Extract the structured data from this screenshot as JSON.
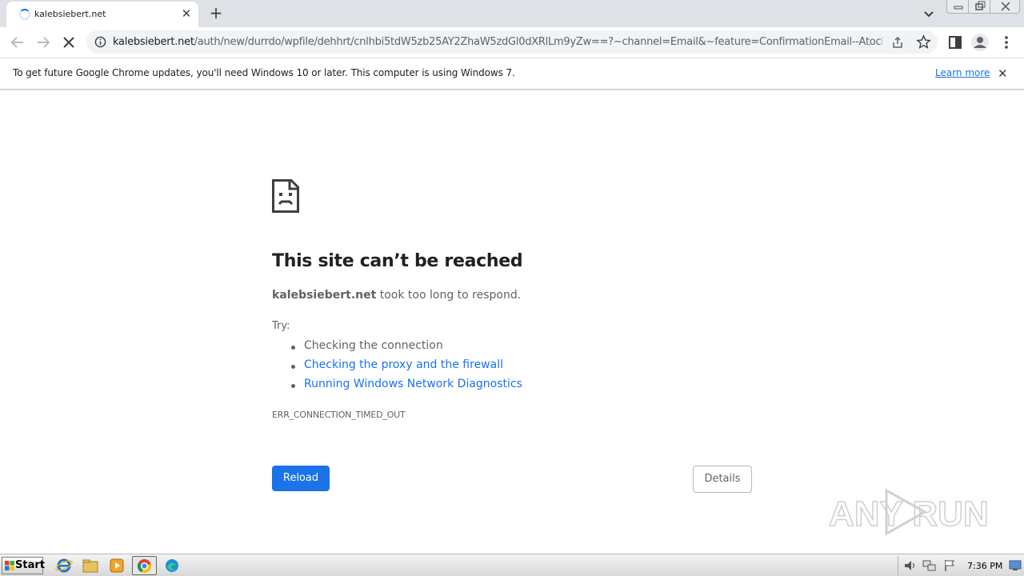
{
  "browser": {
    "tab_title": "kalebsiebert.net",
    "url_host": "kalebsiebert.net",
    "url_path": "/auth/new/durrdo/wpfile/dehhrt/cnlhbi5tdW5zb25AY2ZhaW5zdGl0dXRlLm9yZw==?~channel=Email&~feature=ConfirmationEmail--AtocETI..."
  },
  "infobar": {
    "message": "To get future Google Chrome updates, you'll need Windows 10 or later. This computer is using Windows 7.",
    "link": "Learn more"
  },
  "error": {
    "headline": "This site can’t be reached",
    "host": "kalebsiebert.net",
    "message": "took too long to respond.",
    "try_label": "Try:",
    "suggestions": [
      "Checking the connection",
      "Checking the proxy and the firewall",
      "Running Windows Network Diagnostics"
    ],
    "code": "ERR_CONNECTION_TIMED_OUT",
    "reload_label": "Reload",
    "details_label": "Details"
  },
  "watermark": {
    "text": "ANY RUN"
  },
  "taskbar": {
    "start_label": "Start",
    "clock": "7:36 PM"
  },
  "colors": {
    "accent": "#1a73e8",
    "link": "#1a73e8",
    "text_primary": "#202124",
    "text_secondary": "#5f6368"
  }
}
